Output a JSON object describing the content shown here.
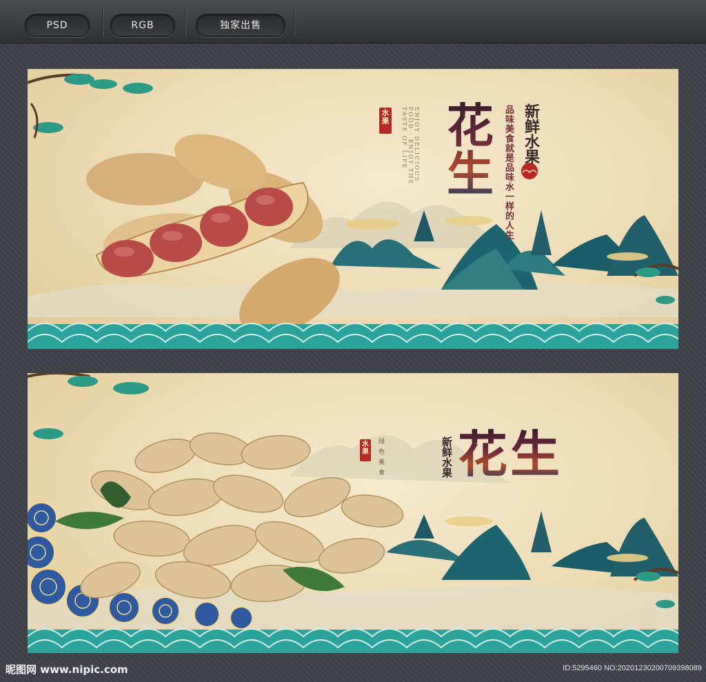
{
  "toolbar": {
    "tabs": [
      {
        "label": "PSD"
      },
      {
        "label": "RGB"
      },
      {
        "label": "独家出售"
      }
    ]
  },
  "banner_top": {
    "title": "花生",
    "subtitle": "新鲜水果",
    "seal": "水果",
    "poem_line_1": "品味美食就是品味水一样的人生",
    "english_caption": "ENJOY DELICIOUS FOOD · ENJOY THE TASTE OF LIFE"
  },
  "banner_bottom": {
    "title": "花生",
    "subtitle": "新鲜水果",
    "seal": "水果",
    "circle_text": "绿色美食"
  },
  "footer": {
    "logo_text": "昵图网 www.nipic.com",
    "image_id": "ID:5295460 NO:20201230200709398089"
  },
  "colors": {
    "background": "#3d4147",
    "paper": "#efe0bb",
    "wave_teal": "#2ba39a",
    "mountain_teal": "#1f6a72",
    "title_red": "#8a2a3a"
  }
}
